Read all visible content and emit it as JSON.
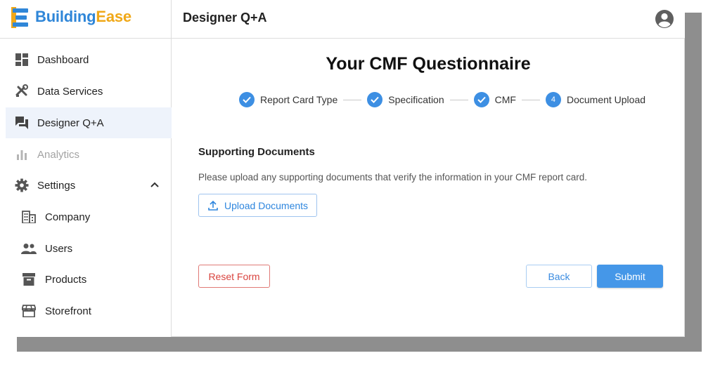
{
  "brand": {
    "part1": "Building",
    "part2": "Ease"
  },
  "sidebar": {
    "items": [
      {
        "label": "Dashboard",
        "icon": "dashboard-icon"
      },
      {
        "label": "Data Services",
        "icon": "tools-icon"
      },
      {
        "label": "Designer Q+A",
        "icon": "forum-icon",
        "active": true
      },
      {
        "label": "Analytics",
        "icon": "bar-chart-icon",
        "disabled": true
      },
      {
        "label": "Settings",
        "icon": "gear-icon",
        "expanded": true
      },
      {
        "label": "Company",
        "icon": "building-icon"
      },
      {
        "label": "Users",
        "icon": "users-icon"
      },
      {
        "label": "Products",
        "icon": "archive-icon"
      },
      {
        "label": "Storefront",
        "icon": "storefront-icon"
      }
    ]
  },
  "header": {
    "title": "Designer Q+A",
    "avatar_icon": "account-circle-icon"
  },
  "main": {
    "title": "Your CMF Questionnaire",
    "steps": [
      {
        "label": "Report Card Type",
        "state": "complete"
      },
      {
        "label": "Specification",
        "state": "complete"
      },
      {
        "label": "CMF",
        "state": "complete"
      },
      {
        "label": "Document Upload",
        "state": "active",
        "number": "4"
      }
    ],
    "section_title": "Supporting Documents",
    "description": "Please upload any supporting documents that verify the information in your CMF report card.",
    "upload_label": "Upload Documents",
    "reset_label": "Reset Form",
    "back_label": "Back",
    "submit_label": "Submit"
  },
  "colors": {
    "primary": "#3d8fe3",
    "brand_blue": "#2f86d8",
    "brand_orange": "#f0a818",
    "danger": "#d9443f"
  }
}
